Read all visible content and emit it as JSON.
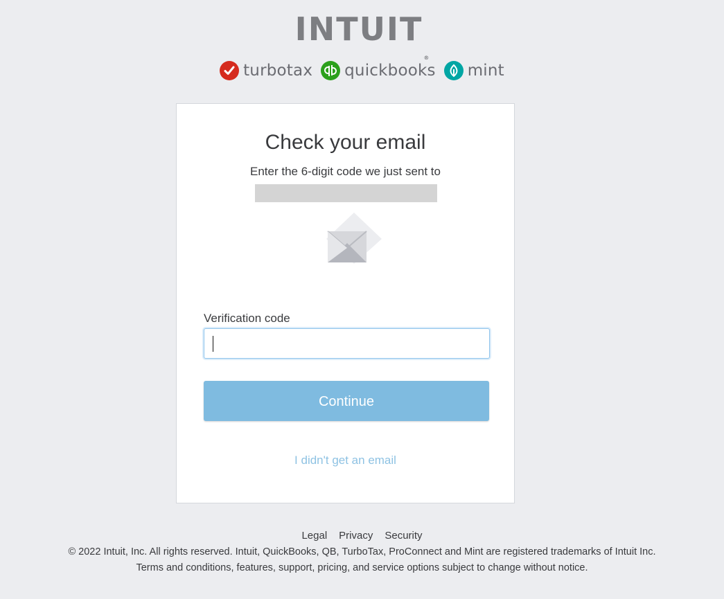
{
  "header": {
    "logo_text": "INTUIT",
    "logo_mark": "®",
    "brands": [
      {
        "name": "turbotax",
        "icon": "checkmark-icon",
        "color": "#d52b1e"
      },
      {
        "name": "quickbooks",
        "icon": "qb-icon",
        "color": "#2ca01c"
      },
      {
        "name": "mint",
        "icon": "leaf-icon",
        "color": "#00a6a4"
      }
    ]
  },
  "card": {
    "title": "Check your email",
    "subtitle": "Enter the 6-digit code we just sent to",
    "envelope_icon": "envelope-icon",
    "field_label": "Verification code",
    "field_value": "",
    "continue_label": "Continue",
    "resend_link": "I didn't get an email"
  },
  "footer": {
    "links": [
      "Legal",
      "Privacy",
      "Security"
    ],
    "copyright_line1": "© 2022 Intuit, Inc. All rights reserved. Intuit, QuickBooks, QB, TurboTax, ProConnect and Mint are registered trademarks of Intuit Inc.",
    "copyright_line2": "Terms and conditions, features, support, pricing, and service options subject to change without notice."
  },
  "colors": {
    "background": "#ecedf0",
    "button": "#7fbbe0",
    "link": "#8ec2e3",
    "input_border": "#8fc4ec"
  }
}
